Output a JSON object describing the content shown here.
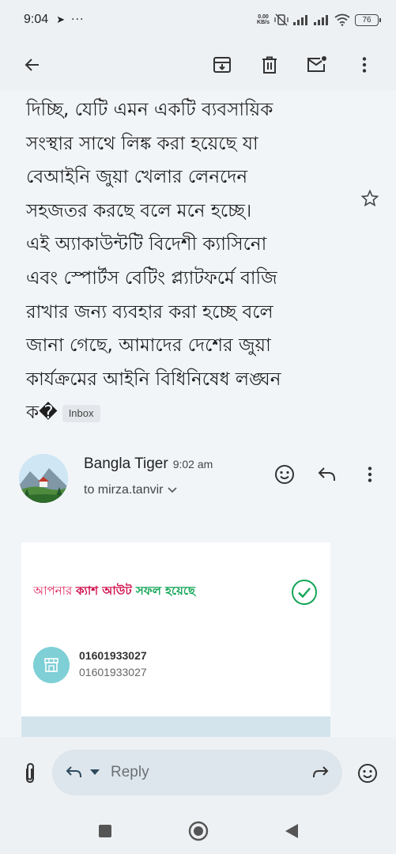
{
  "status_bar": {
    "time": "9:04",
    "speed_value": "0.00",
    "speed_unit": "KB/s",
    "battery": "76"
  },
  "toolbar": {
    "back_icon": "arrow-left-icon",
    "archive_icon": "archive-icon",
    "delete_icon": "trash-icon",
    "mark_unread_icon": "mail-unread-icon",
    "more_icon": "more-vert-icon"
  },
  "email": {
    "body_lines": [
      "দিচ্ছি, যেটি এমন একটি ব্যবসায়িক",
      "সংস্থার সাথে লিঙ্ক করা হয়েছে যা",
      "বেআইনি জুয়া খেলার লেনদেন",
      "সহজতর করছে বলে মনে হচ্ছে।",
      "এই অ্যাকাউন্টটি বিদেশী ক্যাসিনো",
      "এবং স্পোর্টস বেটিং প্ল্যাটফর্মে বাজি",
      "রাখার জন্য ব্যবহার করা হচ্ছে বলে",
      "জানা গেছে, আমাদের দেশের জুয়া",
      "কার্যক্রমের আইনি বিধিনিষেধ লঙ্ঘন",
      "ক�"
    ],
    "label": "Inbox"
  },
  "sender": {
    "name": "Bangla Tiger",
    "time": "9:02 am",
    "to": "to mirza.tanvir"
  },
  "card": {
    "headline_part1": "আপনার ",
    "headline_part2": "ক্যাশ আউট ",
    "headline_part3": " সফল হয়েছে",
    "merchant_name": "01601933027",
    "merchant_number": "01601933027"
  },
  "reply": {
    "label": "Reply"
  },
  "colors": {
    "accent_pink": "#e0245e",
    "success_green": "#13a557",
    "merchant_teal": "#7ecfd6"
  }
}
